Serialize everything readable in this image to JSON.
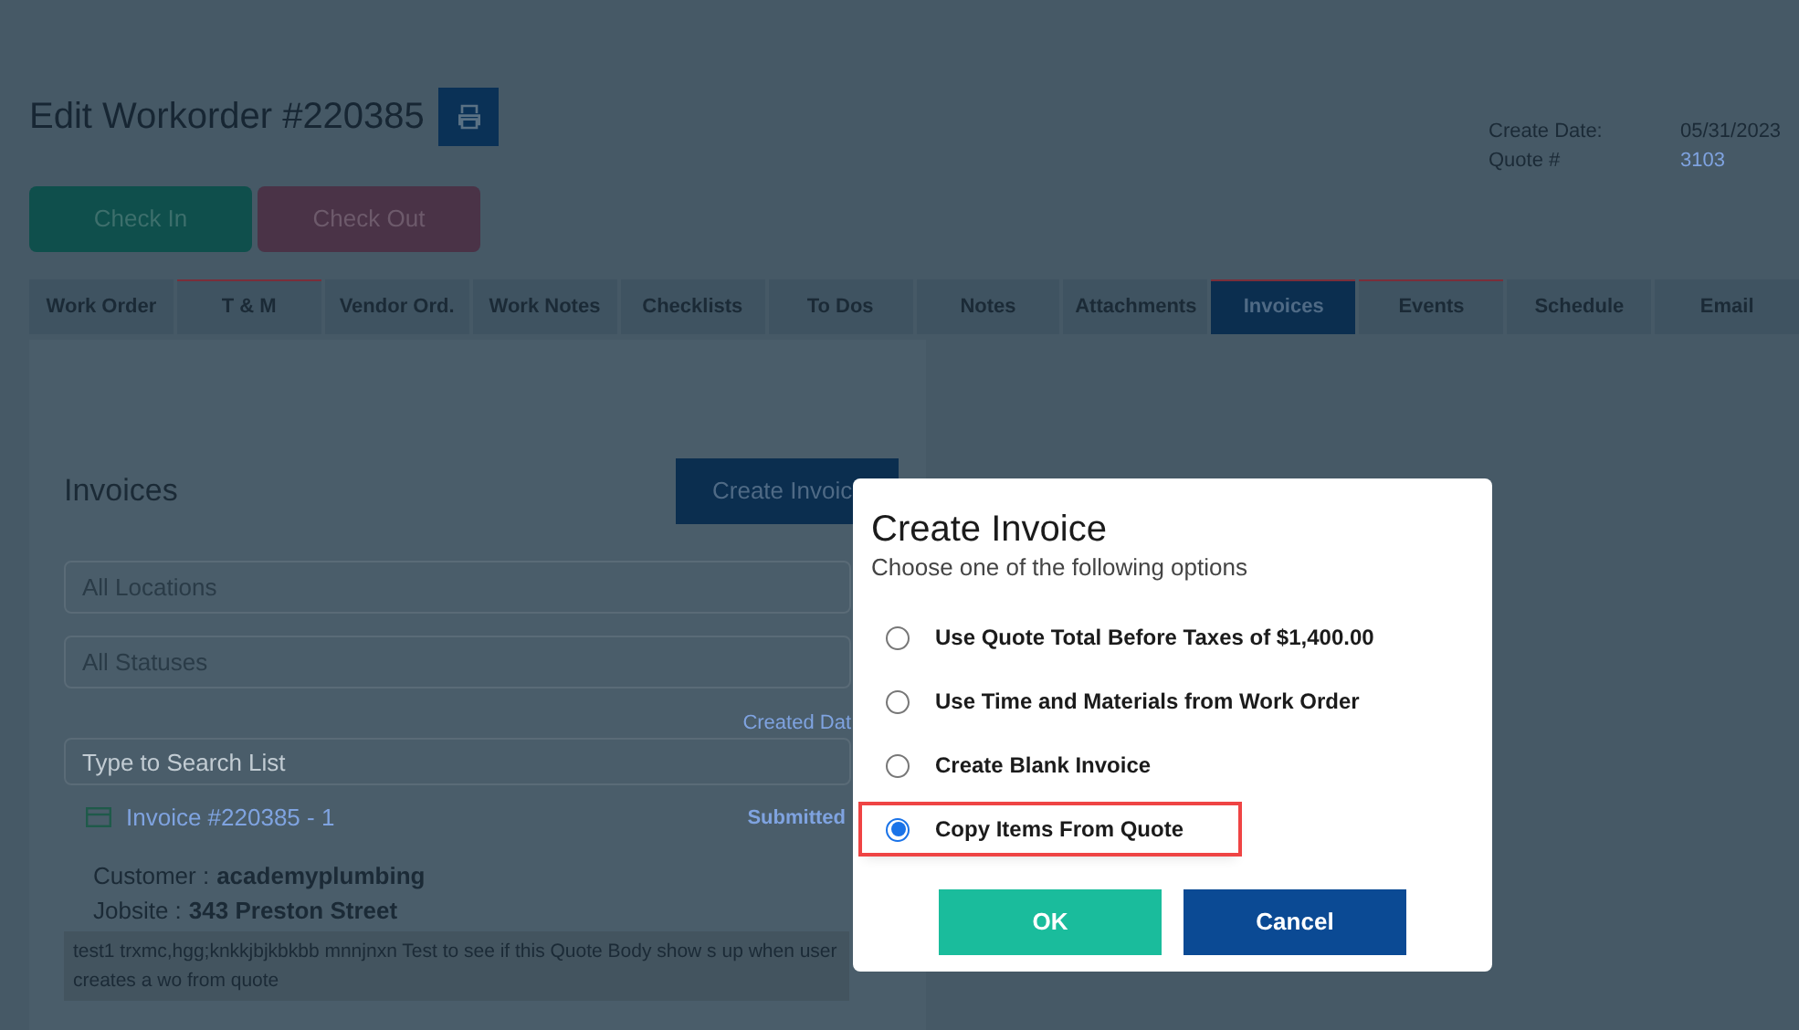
{
  "page": {
    "title": "Edit Workorder #220385",
    "info": [
      {
        "label": "Create Date:",
        "value": "05/31/2023",
        "link": false
      },
      {
        "label": "Quote #",
        "value": "3103",
        "link": true
      }
    ],
    "actions": [
      {
        "label": "Check In",
        "kind": "checkin"
      },
      {
        "label": "Check Out",
        "kind": "checkout"
      }
    ],
    "tabs": [
      {
        "label": "Work Order",
        "selected": false,
        "marked": false
      },
      {
        "label": "T & M",
        "selected": false,
        "marked": true
      },
      {
        "label": "Vendor Ord.",
        "selected": false,
        "marked": false
      },
      {
        "label": "Work Notes",
        "selected": false,
        "marked": false
      },
      {
        "label": "Checklists",
        "selected": false,
        "marked": false
      },
      {
        "label": "To Dos",
        "selected": false,
        "marked": false
      },
      {
        "label": "Notes",
        "selected": false,
        "marked": false
      },
      {
        "label": "Attachments",
        "selected": false,
        "marked": false
      },
      {
        "label": "Invoices",
        "selected": true,
        "marked": true
      },
      {
        "label": "Events",
        "selected": false,
        "marked": true
      },
      {
        "label": "Schedule",
        "selected": false,
        "marked": false
      },
      {
        "label": "Email",
        "selected": false,
        "marked": false
      }
    ],
    "invoices": {
      "heading": "Invoices",
      "create_button": "Create Invoic",
      "location_select": "All Locations",
      "status_select": "All Statuses",
      "sort_label": "Created Dat",
      "search": {
        "placeholder": "Type to Search List"
      },
      "items": [
        {
          "title": "Invoice #220385 - 1",
          "status": "Submitted",
          "customer_label": "Customer :",
          "customer": "academyplumbing",
          "jobsite_label": "Jobsite :",
          "jobsite": "343 Preston Street",
          "body": "test1 trxmc,hgg;knkkjbjkbkbb mnnjnxn Test to see if this Quote Body show s up when user creates a wo from quote"
        }
      ]
    }
  },
  "dialog": {
    "title": "Create Invoice",
    "subtitle": "Choose one of the following options",
    "options": [
      {
        "label": "Use Quote Total Before Taxes of $1,400.00",
        "selected": false
      },
      {
        "label": "Use Time and Materials from Work Order",
        "selected": false
      },
      {
        "label": "Create Blank Invoice",
        "selected": false
      },
      {
        "label": "Copy Items From Quote",
        "selected": true
      }
    ],
    "buttons": [
      {
        "label": "OK",
        "kind": "primary"
      },
      {
        "label": "Cancel",
        "kind": "secondary"
      }
    ]
  }
}
